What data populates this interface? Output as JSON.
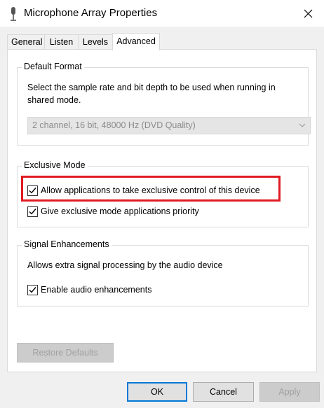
{
  "window": {
    "title": "Microphone Array Properties"
  },
  "tabs": [
    {
      "label": "General"
    },
    {
      "label": "Listen"
    },
    {
      "label": "Levels"
    },
    {
      "label": "Advanced"
    }
  ],
  "default_format": {
    "legend": "Default Format",
    "description_line1": "Select the sample rate and bit depth to be used when running in",
    "description_line2": "shared mode.",
    "selected_format": "2 channel, 16 bit, 48000 Hz (DVD Quality)"
  },
  "exclusive_mode": {
    "legend": "Exclusive Mode",
    "allow_exclusive_label": "Allow applications to take exclusive control of this device",
    "allow_exclusive_checked": true,
    "priority_label": "Give exclusive mode applications priority",
    "priority_checked": true
  },
  "signal_enhancements": {
    "legend": "Signal Enhancements",
    "description": "Allows extra signal processing by the audio device",
    "enable_label": "Enable audio enhancements",
    "enable_checked": true
  },
  "buttons": {
    "restore_defaults": "Restore Defaults",
    "ok": "OK",
    "cancel": "Cancel",
    "apply": "Apply"
  },
  "colors": {
    "highlight": "#e01a22",
    "primary_border": "#0078d7"
  }
}
